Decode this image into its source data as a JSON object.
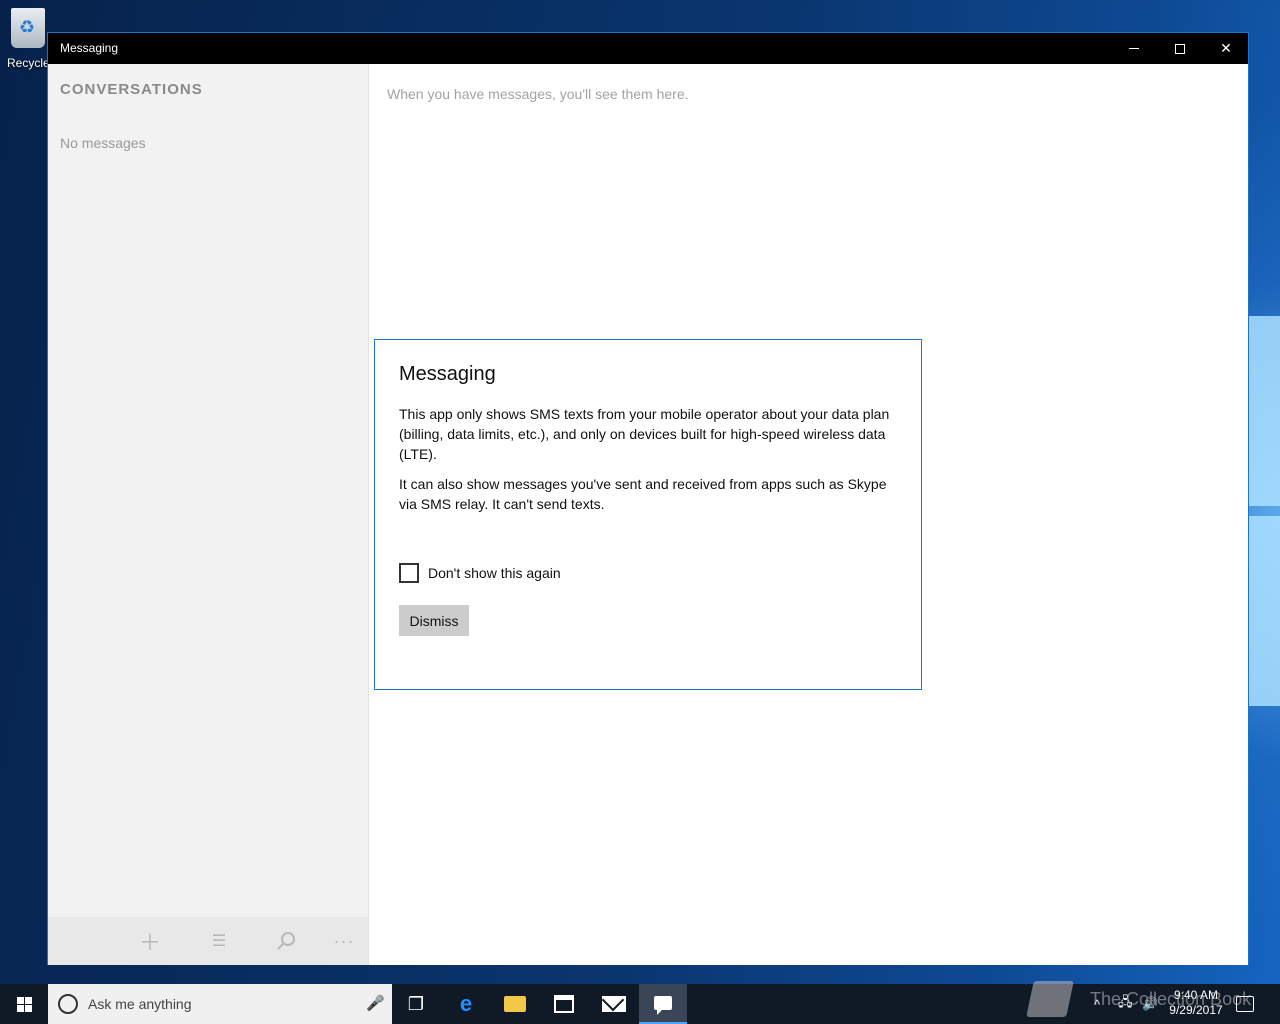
{
  "desktop": {
    "recycle_bin_label": "Recycle"
  },
  "window": {
    "title": "Messaging"
  },
  "sidebar": {
    "header": "CONVERSATIONS",
    "empty_text": "No messages",
    "appbar": {
      "new_icon": "plus-icon",
      "select_icon": "select-list-icon",
      "search_icon": "search-icon",
      "more_label": "···"
    }
  },
  "main": {
    "empty_text": "When you have messages, you'll see them here."
  },
  "dialog": {
    "title": "Messaging",
    "paragraph1": "This app only shows SMS texts from your mobile operator about your data plan (billing, data limits, etc.), and only on devices built for high-speed wireless data (LTE).",
    "paragraph2": "It can also show messages you've sent and received from apps such as Skype via SMS relay. It can't send texts.",
    "checkbox_label": "Don't show this again",
    "checkbox_checked": false,
    "dismiss_label": "Dismiss"
  },
  "taskbar": {
    "search_placeholder": "Ask me anything",
    "time": "9:40 AM",
    "date": "9/29/2017",
    "active_app": "Messaging"
  },
  "watermark": {
    "text": "The Collection Book"
  },
  "colors": {
    "accent": "#1a73c9",
    "titlebar": "#000000",
    "taskbar": "#101a27"
  }
}
